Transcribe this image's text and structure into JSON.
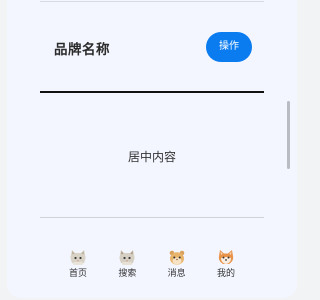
{
  "header": {
    "title": "品牌名称",
    "action_label": "操作"
  },
  "main": {
    "center_text": "居中内容"
  },
  "tabbar": {
    "items": [
      {
        "label": "首页",
        "icon": "cat-icon"
      },
      {
        "label": "搜索",
        "icon": "cat-icon"
      },
      {
        "label": "消息",
        "icon": "hamster-icon"
      },
      {
        "label": "我的",
        "icon": "shiba-icon"
      }
    ]
  },
  "colors": {
    "accent": "#0a7cf0",
    "background": "#f3f6ff"
  }
}
